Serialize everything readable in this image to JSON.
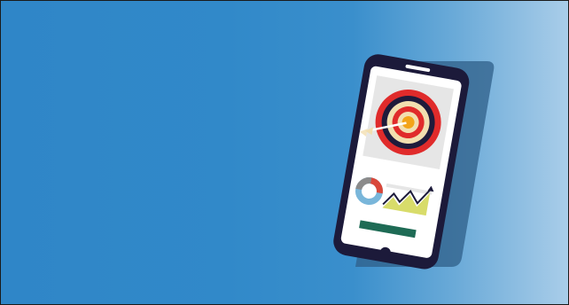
{
  "banner": {
    "background_gradient": [
      "#2f86c8",
      "#3a8fcc",
      "#a9cde9"
    ],
    "illustration": {
      "subject": "smartphone",
      "icons": [
        "target-icon",
        "arrow-icon",
        "donut-chart-icon",
        "line-chart-icon"
      ],
      "colors": {
        "phone_frame": "#1c1a3a",
        "phone_shadow": "#2f5f88",
        "screen": "#ffffff",
        "panel": "#e6e6e6",
        "target_red": "#e02b2b",
        "target_dark": "#1f1b3b",
        "target_cream": "#f2dfb0",
        "target_center": "#f3a419",
        "chart_yellow": "#d8dc6a",
        "donut_blue": "#79b6da",
        "donut_red": "#d9473a",
        "donut_grey": "#8b8b8b",
        "bar_green": "#1e6b55"
      }
    }
  }
}
